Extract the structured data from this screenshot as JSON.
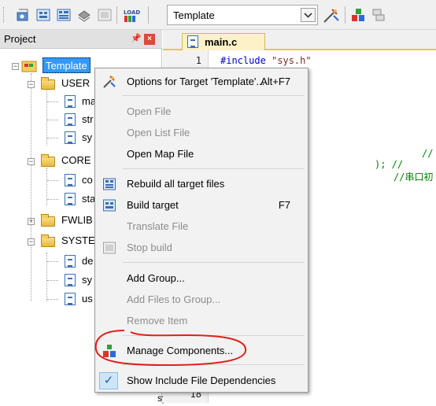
{
  "toolbar": {
    "target_value": "Template",
    "icons": [
      "translate-icon",
      "build-icon",
      "rebuild-icon",
      "batch-build-icon",
      "stop-build-icon",
      "load-download-icon",
      "target-options-icon",
      "manage-components-icon",
      "select-packs-icon"
    ],
    "load_label": "LOAD"
  },
  "project_panel": {
    "title": "Project",
    "pin_glyph": "█",
    "close_glyph": "×",
    "tree": {
      "root": "Template",
      "groups": [
        {
          "name": "USER",
          "files": [
            "ma",
            "str",
            "sy"
          ]
        },
        {
          "name": "CORE",
          "files": [
            "co",
            "sta"
          ]
        },
        {
          "name": "FWLIB",
          "files": []
        },
        {
          "name": "SYSTE",
          "files": [
            "de",
            "sy",
            "us"
          ]
        }
      ],
      "bottom_file": "sys.c"
    }
  },
  "editor": {
    "tab_label": "main.c",
    "line_numbers": [
      "1",
      "18"
    ],
    "code": {
      "include_kw": "#include",
      "include_arg": "\"sys.h\"",
      "fragments": [
        "//",
        "); //",
        "//串口初"
      ]
    }
  },
  "context_menu": {
    "items": [
      {
        "label": "Options for Target 'Template'...",
        "shortcut": "Alt+F7",
        "enabled": true,
        "icon": "target-options-icon"
      },
      {
        "label": "Open File",
        "enabled": false
      },
      {
        "label": "Open List File",
        "enabled": false
      },
      {
        "label": "Open Map File",
        "enabled": true
      },
      {
        "label": "Rebuild all target files",
        "enabled": true,
        "icon": "rebuild-icon"
      },
      {
        "label": "Build target",
        "shortcut": "F7",
        "enabled": true,
        "icon": "build-icon"
      },
      {
        "label": "Translate File",
        "enabled": false
      },
      {
        "label": "Stop build",
        "enabled": false,
        "icon": "stop-build-icon"
      },
      {
        "label": "Add Group...",
        "enabled": true
      },
      {
        "label": "Add Files to Group...",
        "enabled": false
      },
      {
        "label": "Remove Item",
        "enabled": false
      },
      {
        "label": "Manage Components...",
        "enabled": true,
        "icon": "manage-components-icon",
        "highlighted": true
      },
      {
        "label": "Show Include File Dependencies",
        "enabled": true,
        "checked": true
      }
    ]
  },
  "colors": {
    "annotation": "#e0201a",
    "tab_accent": "#f5c342",
    "selection": "#3399ff",
    "disabled_text": "#8d8d8d"
  }
}
